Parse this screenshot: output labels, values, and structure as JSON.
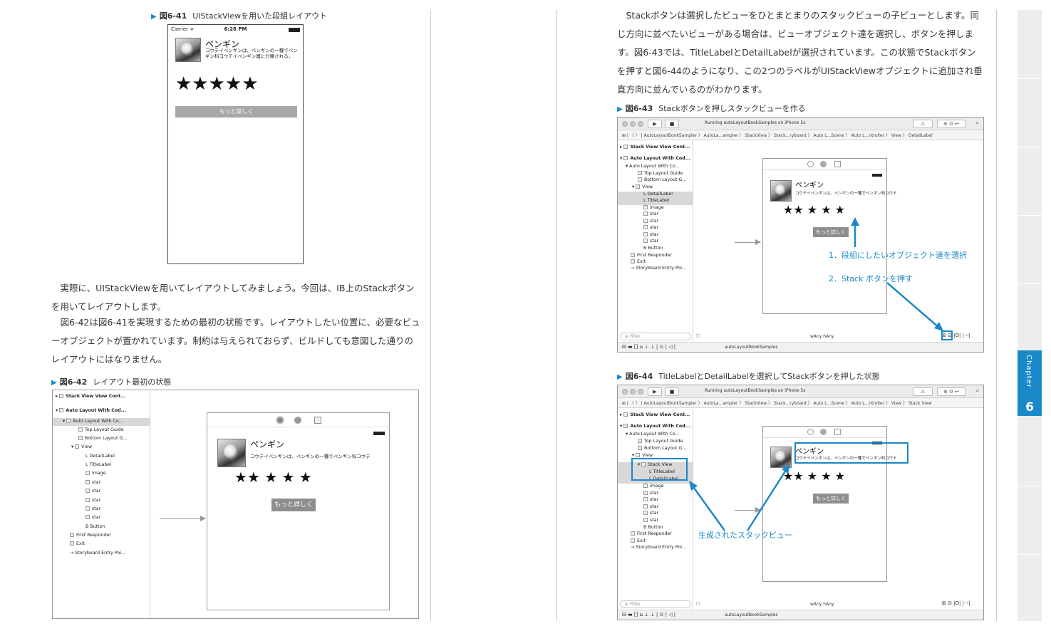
{
  "left": {
    "fig41": {
      "num": "図6-41",
      "title": "UIStackViewを用いた段組レイアウト"
    },
    "phone41": {
      "carrier": "Carrier ᯤ",
      "time": "6:26 PM",
      "title": "ペンギン",
      "detail": "コウテイペンギンは、ペンギンの一種でペンギン科コウテイペンギン属に分類される。",
      "stars": "★★★★★",
      "button": "もっと詳しく"
    },
    "paragraph1": "実際に、UIStackViewを用いてレイアウトしてみましょう。今回は、IB上のStackボタンを用いてレイアウトします。",
    "paragraph2": "図6-42は図6-41を実現するための最初の状態です。レイアウトしたい位置に、必要なビューオブジェクトが置かれています。制約は与えられておらず、ビルドしても意図した通りのレイアウトにはなりません。",
    "fig42": {
      "num": "図6-42",
      "title": "レイアウト最初の状態"
    },
    "ib42": {
      "outline": [
        "Stack View View Cont...",
        "Auto Layout With Cod...",
        "Auto Layout With Co...",
        "Top Layout Guide",
        "Bottom Layout G...",
        "View",
        "DetailLabel",
        "TitleLabel",
        "image",
        "star",
        "star",
        "star",
        "star",
        "star",
        "Button",
        "First Responder",
        "Exit",
        "Storyboard Entry Poi..."
      ],
      "title": "ペンギン",
      "detail": "コウテイペンギンは、ペンギンの一種でペンギン科コウテ",
      "stars": "★★ ★ ★ ★",
      "button": "もっと詳しく"
    }
  },
  "right": {
    "paragraph": "Stackボタンは選択したビューをひとまとまりのスタックビューの子ビューとします。同じ方向に並べたいビューがある場合は、ビューオブジェクト達を選択し、ボタンを押します。図6-43では、TitleLabelとDetailLabelが選択されています。この状態でStackボタンを押すと図6-44のようになり、この2つのラベルがUIStackViewオブジェクトに追加され垂直方向に並んでいるのがわかります。",
    "fig43": {
      "num": "図6-43",
      "title": "Stackボタンを押しスタックビューを作る"
    },
    "ib43": {
      "running": "Running autoLayoutBookSamples on iPhone 5s",
      "jump": "AutoLayoutBookSampler 〉 AutoLa...ampler 〉 StackView 〉 Stack...ryboard 〉 Auto L...Scene 〉 Auto L...ntroller 〉 View 〉 DetailLabel",
      "outline": [
        "Stack View View Cont...",
        "Auto Layout With Cod...",
        "Auto Layout With Co...",
        "Top Layout Guide",
        "Bottom Layout G...",
        "View",
        "DetailLabel",
        "TitleLabel",
        "image",
        "star",
        "star",
        "star",
        "star",
        "star",
        "Button",
        "First Responder",
        "Exit",
        "Storyboard Entry Poi..."
      ],
      "title": "ペンギン",
      "detail": "コウテイペンギンは、ペンギンの一種でペンギン科コウテ",
      "stars": "★★ ★ ★ ★",
      "button": "もっと詳しく",
      "filter": "Filter",
      "size": "wAny hAny",
      "footer": "autoLayoutBookSamples",
      "note1": "1．段組にしたいオブジェクト達を選択",
      "note2": "2．Stack ボタンを押す"
    },
    "fig44": {
      "num": "図6-44",
      "title": "TitleLabelとDetailLabelを選択してStackボタンを押した状態"
    },
    "ib44": {
      "running": "Running autoLayoutBookSamples on iPhone 5s",
      "jump": "AutoLayoutBookSampler 〉 AutoLa...ampler 〉 StackView 〉 Stack...ryboard 〉 Auto L...Scene 〉 Auto L...ntroller 〉 View 〉 Stack View",
      "outline": [
        "Stack View View Cont...",
        "Auto Layout With Cod...",
        "Auto Layout With Co...",
        "Top Layout Guide",
        "Bottom Layout G...",
        "View",
        "Stack View",
        "TitleLabel",
        "DetailLabel",
        "image",
        "star",
        "star",
        "star",
        "star",
        "star",
        "Button",
        "First Responder",
        "Exit",
        "Storyboard Entry Poi..."
      ],
      "title": "ペンギン",
      "detail": "コウテイペンギンは、ペンギンの一種でペンギン科コウテ",
      "stars": "★★ ★ ★ ★",
      "button": "もっと詳しく",
      "filter": "Filter",
      "size": "wAny hAny",
      "footer": "autoLayoutBookSamples",
      "note": "生成されたスタックビュー"
    }
  },
  "chapter": {
    "label": "Chapter",
    "number": "6"
  },
  "colors": {
    "accent": "#1a88c9"
  }
}
